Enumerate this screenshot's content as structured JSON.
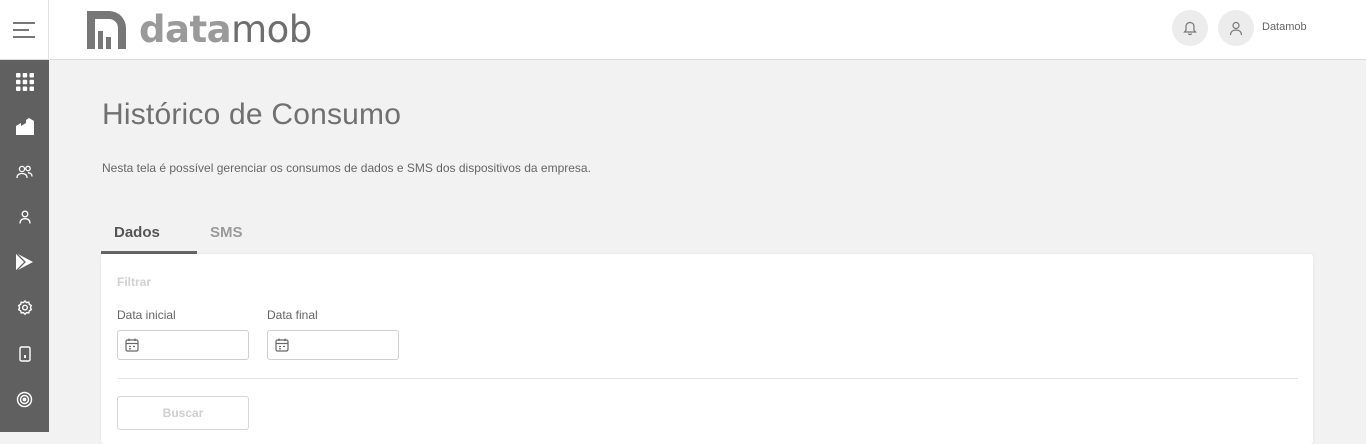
{
  "brand": {
    "logo_bold": "data",
    "logo_light": "mob"
  },
  "header": {
    "user_name": "Datamob",
    "icons": [
      "menu-icon",
      "bell-icon",
      "user-icon"
    ]
  },
  "sidebar": {
    "items": [
      {
        "icon": "apps-grid-icon"
      },
      {
        "icon": "company-icon"
      },
      {
        "icon": "users-icon"
      },
      {
        "icon": "user-icon"
      },
      {
        "icon": "play-store-icon"
      },
      {
        "icon": "settings-icon"
      },
      {
        "icon": "device-icon"
      },
      {
        "icon": "signal-icon"
      }
    ]
  },
  "page": {
    "title": "Histórico de Consumo",
    "description": "Nesta tela é possível gerenciar os consumos de dados e SMS dos dispositivos da empresa."
  },
  "tabs": [
    {
      "label": "Dados",
      "active": true
    },
    {
      "label": "SMS",
      "active": false
    }
  ],
  "filter": {
    "title": "Filtrar",
    "start_date_label": "Data inicial",
    "start_date_value": "",
    "end_date_label": "Data final",
    "end_date_value": "",
    "search_button": "Buscar"
  },
  "colors": {
    "sidebar_bg": "#606060",
    "page_bg": "#f2f2f2",
    "logo_bold": "#9a9a9a",
    "logo_light": "#6e6e6e"
  }
}
